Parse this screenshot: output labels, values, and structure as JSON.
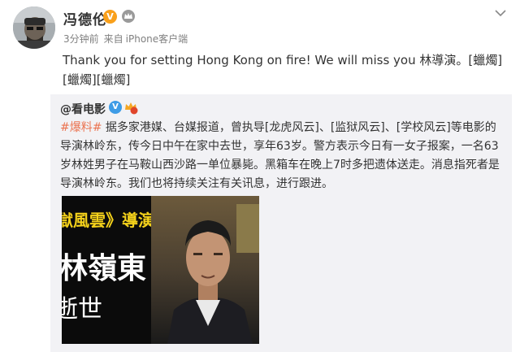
{
  "post": {
    "author": "冯德伦",
    "verified_icon": "v-badge-icon",
    "time": "3分钟前",
    "source_prefix": "来自",
    "source": "iPhone客户端",
    "text": "Thank you for setting Hong Kong on fire! We will miss you 林導演。[蠟燭][蠟燭][蠟燭]"
  },
  "repost": {
    "author": "@看电影",
    "hashtag": "#爆料#",
    "text": " 据多家港媒、台媒报道，曾执导[龙虎风云]、[监狱风云]、[学校风云]等电影的导演林岭东，传今日中午在家中去世，享年63岁。警方表示今日有一女子报案，一名63岁林姓男子在马鞍山西沙路一单位暴毙。黑箱车在晚上7时多把遗体送走。消息指死者是导演林岭东。我们也将持续关注有关讯息，进行跟进。",
    "image": {
      "line1": "獄風雲》導演",
      "line2": "林嶺東",
      "line3": "逝世"
    }
  },
  "colors": {
    "hashtag": "#eb7350",
    "gold_badge": "#f9a01b",
    "blue_badge": "#3e9ce6",
    "repost_bg": "#f2f2f5",
    "image_title": "#f5d21b"
  }
}
